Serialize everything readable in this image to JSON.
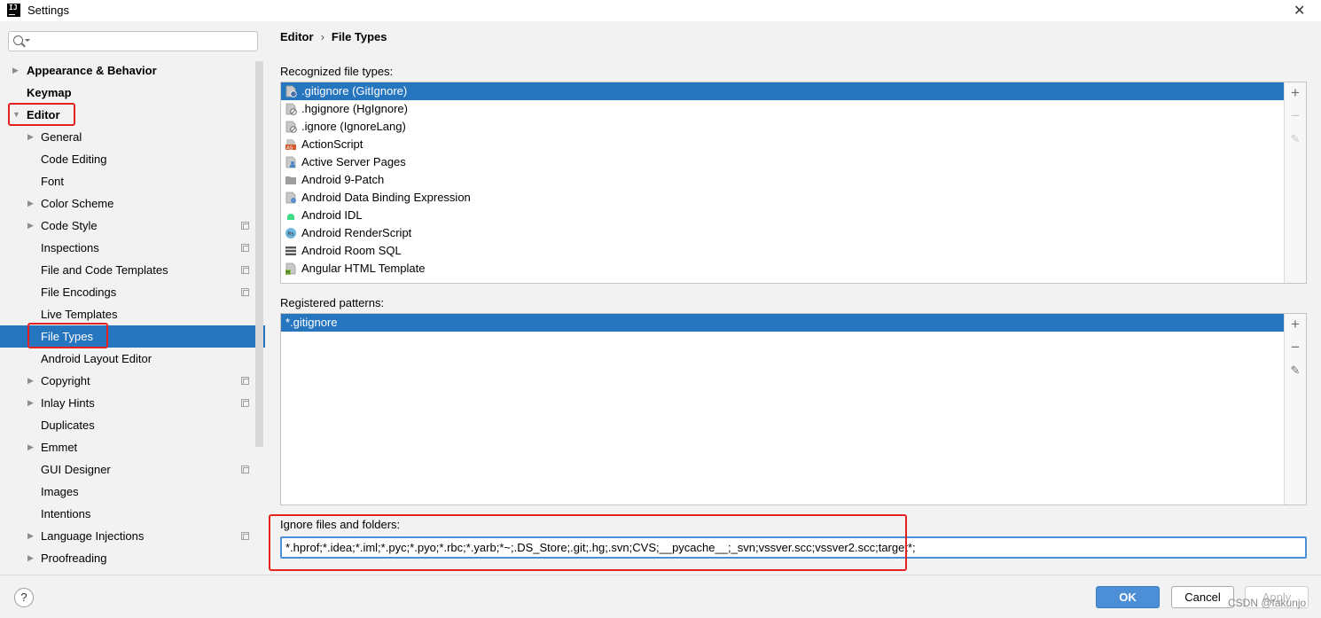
{
  "window": {
    "title": "Settings",
    "app_icon_text": "IJ"
  },
  "sidebar": {
    "search_placeholder": "",
    "items": [
      {
        "label": "Appearance & Behavior",
        "level": 0,
        "arrow": "right",
        "bold": true
      },
      {
        "label": "Keymap",
        "level": 0,
        "arrow": "",
        "bold": true
      },
      {
        "label": "Editor",
        "level": 0,
        "arrow": "down",
        "bold": true
      },
      {
        "label": "General",
        "level": 1,
        "arrow": "right"
      },
      {
        "label": "Code Editing",
        "level": 1,
        "arrow": ""
      },
      {
        "label": "Font",
        "level": 1,
        "arrow": ""
      },
      {
        "label": "Color Scheme",
        "level": 1,
        "arrow": "right"
      },
      {
        "label": "Code Style",
        "level": 1,
        "arrow": "right",
        "project_icon": true
      },
      {
        "label": "Inspections",
        "level": 1,
        "arrow": "",
        "project_icon": true
      },
      {
        "label": "File and Code Templates",
        "level": 1,
        "arrow": "",
        "project_icon": true
      },
      {
        "label": "File Encodings",
        "level": 1,
        "arrow": "",
        "project_icon": true
      },
      {
        "label": "Live Templates",
        "level": 1,
        "arrow": ""
      },
      {
        "label": "File Types",
        "level": 1,
        "arrow": "",
        "selected": true
      },
      {
        "label": "Android Layout Editor",
        "level": 1,
        "arrow": ""
      },
      {
        "label": "Copyright",
        "level": 1,
        "arrow": "right",
        "project_icon": true
      },
      {
        "label": "Inlay Hints",
        "level": 1,
        "arrow": "right",
        "project_icon": true
      },
      {
        "label": "Duplicates",
        "level": 1,
        "arrow": ""
      },
      {
        "label": "Emmet",
        "level": 1,
        "arrow": "right"
      },
      {
        "label": "GUI Designer",
        "level": 1,
        "arrow": "",
        "project_icon": true
      },
      {
        "label": "Images",
        "level": 1,
        "arrow": ""
      },
      {
        "label": "Intentions",
        "level": 1,
        "arrow": ""
      },
      {
        "label": "Language Injections",
        "level": 1,
        "arrow": "right",
        "project_icon": true
      },
      {
        "label": "Proofreading",
        "level": 1,
        "arrow": "right"
      }
    ]
  },
  "main": {
    "breadcrumb": {
      "parent": "Editor",
      "separator": "›",
      "current": "File Types"
    },
    "recognized_label": "Recognized file types:",
    "file_types": [
      {
        "name": ".gitignore (GitIgnore)",
        "icon": "gitignore-icon",
        "selected": true
      },
      {
        "name": ".hgignore (HgIgnore)",
        "icon": "hgignore-icon"
      },
      {
        "name": ".ignore (IgnoreLang)",
        "icon": "ignore-icon"
      },
      {
        "name": "ActionScript",
        "icon": "actionscript-icon"
      },
      {
        "name": "Active Server Pages",
        "icon": "asp-icon"
      },
      {
        "name": "Android 9-Patch",
        "icon": "folder-icon"
      },
      {
        "name": "Android Data Binding Expression",
        "icon": "databinding-icon"
      },
      {
        "name": "Android IDL",
        "icon": "android-icon"
      },
      {
        "name": "Android RenderScript",
        "icon": "renderscript-icon"
      },
      {
        "name": "Android Room SQL",
        "icon": "database-icon"
      },
      {
        "name": "Angular HTML Template",
        "icon": "html-icon"
      }
    ],
    "registered_label": "Registered patterns:",
    "patterns": [
      {
        "value": "*.gitignore",
        "selected": true
      }
    ],
    "ignore_label": "Ignore files and folders:",
    "ignore_value": "*.hprof;*.idea;*.iml;*.pyc;*.pyo;*.rbc;*.yarb;*~;.DS_Store;.git;.hg;.svn;CVS;__pycache__;_svn;vssver.scc;vssver2.scc;target*;"
  },
  "footer": {
    "help_label": "?",
    "ok_label": "OK",
    "cancel_label": "Cancel",
    "apply_label": "Apply"
  },
  "watermark": "CSDN @fakunjo",
  "colors": {
    "selection": "#2675bf",
    "highlight": "#e52020",
    "ok_button": "#4d8fd6"
  }
}
